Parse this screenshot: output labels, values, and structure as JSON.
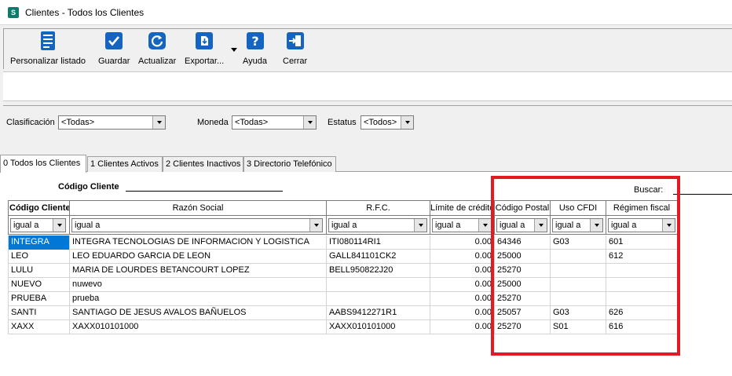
{
  "window": {
    "title": "Clientes - Todos los Clientes",
    "app_icon_letter": "S"
  },
  "toolbar": {
    "customize": "Personalizar listado",
    "save": "Guardar",
    "refresh": "Actualizar",
    "export": "Exportar...",
    "help": "Ayuda",
    "close": "Cerrar"
  },
  "filters": {
    "classification_label": "Clasificación",
    "classification_value": "<Todas>",
    "currency_label": "Moneda",
    "currency_value": "<Todas>",
    "status_label": "Estatus",
    "status_value": "<Todos>"
  },
  "tabs": [
    "0 Todos los Clientes",
    "1 Clientes Activos",
    "2 Clientes Inactivos",
    "3 Directorio Telefónico"
  ],
  "search": {
    "code_label": "Código Cliente",
    "search_label": "Buscar:"
  },
  "grid": {
    "columns": [
      "Código Cliente",
      "Razón Social",
      "R.F.C.",
      "Límite de crédito",
      "Código Postal",
      "Uso CFDI",
      "Régimen fiscal"
    ],
    "filter_value": "igual a",
    "rows": [
      {
        "code": "INTEGRA",
        "name": "INTEGRA TECNOLOGIAS DE INFORMACION Y LOGISTICA",
        "rfc": "ITI080114RI1",
        "limit": "0.00",
        "cp": "64346",
        "cfdi": "G03",
        "regimen": "601"
      },
      {
        "code": "LEO",
        "name": "LEO EDUARDO GARCIA DE LEON",
        "rfc": "GALL841101CK2",
        "limit": "0.00",
        "cp": "25000",
        "cfdi": "",
        "regimen": "612"
      },
      {
        "code": "LULU",
        "name": "MARIA DE LOURDES BETANCOURT LOPEZ",
        "rfc": "BELL950822J20",
        "limit": "0.00",
        "cp": "25270",
        "cfdi": "",
        "regimen": ""
      },
      {
        "code": "NUEVO",
        "name": "nuwevo",
        "rfc": "",
        "limit": "0.00",
        "cp": "25000",
        "cfdi": "",
        "regimen": ""
      },
      {
        "code": "PRUEBA",
        "name": "prueba",
        "rfc": "",
        "limit": "0.00",
        "cp": "25270",
        "cfdi": "",
        "regimen": ""
      },
      {
        "code": "SANTI",
        "name": "SANTIAGO DE JESUS AVALOS BAÑUELOS",
        "rfc": "AABS9412271R1",
        "limit": "0.00",
        "cp": "25057",
        "cfdi": "G03",
        "regimen": "626"
      },
      {
        "code": "XAXX",
        "name": "XAXX010101000",
        "rfc": "XAXX010101000",
        "limit": "0.00",
        "cp": "25270",
        "cfdi": "S01",
        "regimen": "616"
      }
    ]
  },
  "colors": {
    "accent": "#0078d7",
    "highlight": "#e21b22",
    "icon_blue": "#1565c0"
  }
}
